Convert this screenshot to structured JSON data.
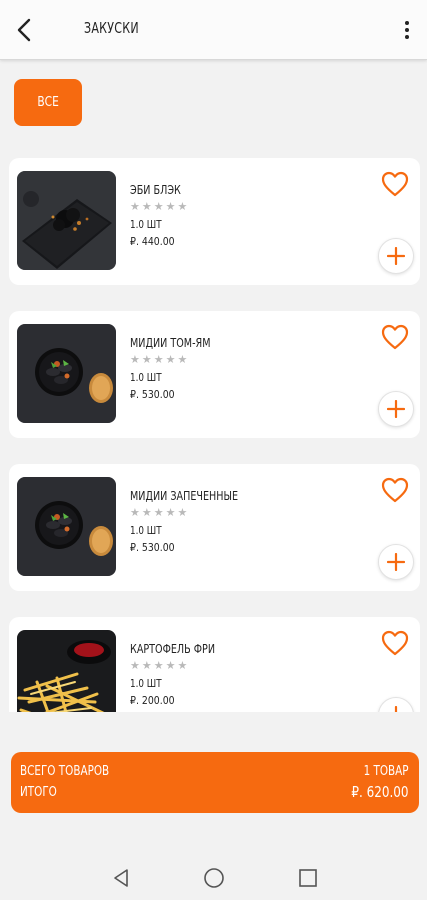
{
  "header": {
    "title": "ЗАКУСКИ",
    "back_icon": "back-arrow-icon",
    "menu_icon": "more-vertical-icon"
  },
  "filter": {
    "label": "ВСЕ",
    "color": "#f66a10"
  },
  "products": [
    {
      "name": "ЭБИ БЛЭК",
      "quantity": "1.0 ШТ",
      "price": "₽. 440.00",
      "rating": 0,
      "image": "shrimp-dish-image"
    },
    {
      "name": "МИДИИ ТОМ-ЯМ",
      "quantity": "1.0 ШТ",
      "price": "₽. 530.00",
      "rating": 0,
      "image": "mussels-dish-image"
    },
    {
      "name": "МИДИИ ЗАПЕЧЕННЫЕ",
      "quantity": "1.0 ШТ",
      "price": "₽. 530.00",
      "rating": 0,
      "image": "mussels-dish-image"
    },
    {
      "name": "КАРТОФЕЛЬ ФРИ",
      "quantity": "1.0 ШТ",
      "price": "₽. 200.00",
      "rating": 0,
      "image": "fries-image"
    }
  ],
  "cart": {
    "items_label": "ВСЕГО ТОВАРОВ",
    "items_value": "1 ТОВАР",
    "total_label": "ИТОГО",
    "total_value": "₽. 620.00"
  },
  "colors": {
    "accent": "#f66a10",
    "background": "#f2f2f2",
    "card": "#ffffff",
    "star_empty": "#b9b9b9"
  },
  "navigation": [
    "back-triangle-icon",
    "home-circle-icon",
    "recents-square-icon"
  ]
}
